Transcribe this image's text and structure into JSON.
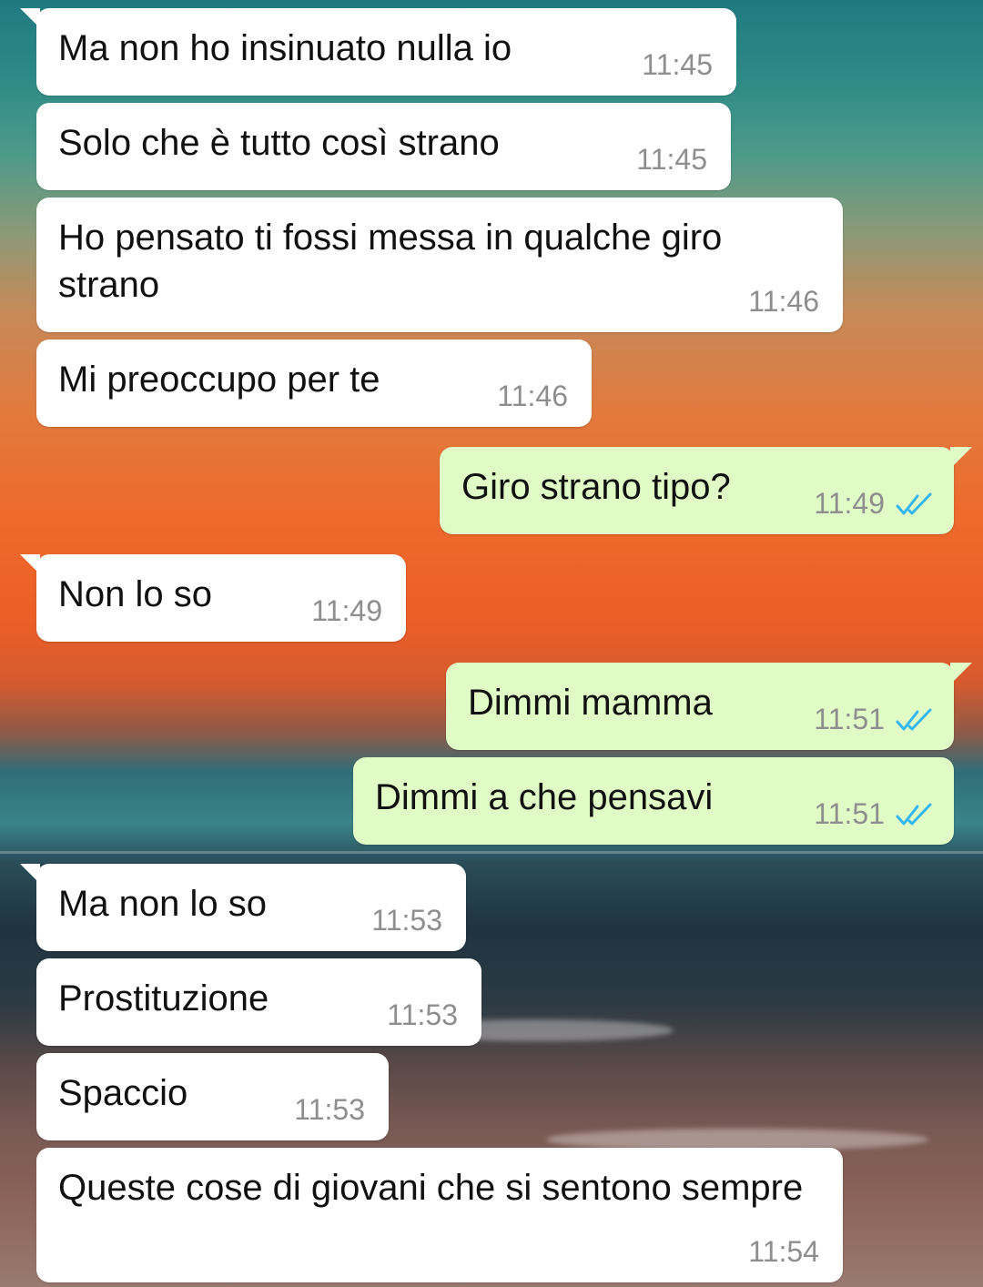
{
  "colors": {
    "incoming_bubble": "#ffffff",
    "outgoing_bubble": "#e0fbc6",
    "read_check": "#34b7f1",
    "timestamp": "#8e8e8e"
  },
  "messages": [
    {
      "direction": "incoming",
      "text": "Ma non ho insinuato nulla io",
      "time": "11:45"
    },
    {
      "direction": "incoming",
      "text": "Solo che è tutto così strano",
      "time": "11:45"
    },
    {
      "direction": "incoming",
      "text": "Ho pensato ti fossi messa in qualche giro strano",
      "time": "11:46"
    },
    {
      "direction": "incoming",
      "text": "Mi preoccupo per te",
      "time": "11:46"
    },
    {
      "direction": "outgoing",
      "text": "Giro strano tipo?",
      "time": "11:49",
      "status_icon": "double-check-read-icon"
    },
    {
      "direction": "incoming",
      "text": "Non lo so",
      "time": "11:49"
    },
    {
      "direction": "outgoing",
      "text": "Dimmi mamma",
      "time": "11:51",
      "status_icon": "double-check-read-icon"
    },
    {
      "direction": "outgoing",
      "text": "Dimmi a che pensavi",
      "time": "11:51",
      "status_icon": "double-check-read-icon"
    },
    {
      "direction": "incoming",
      "text": "Ma non lo so",
      "time": "11:53"
    },
    {
      "direction": "incoming",
      "text": "Prostituzione",
      "time": "11:53"
    },
    {
      "direction": "incoming",
      "text": "Spaccio",
      "time": "11:53"
    },
    {
      "direction": "incoming",
      "text": "Queste cose di giovani che si sentono sempre",
      "time": "11:54"
    }
  ]
}
